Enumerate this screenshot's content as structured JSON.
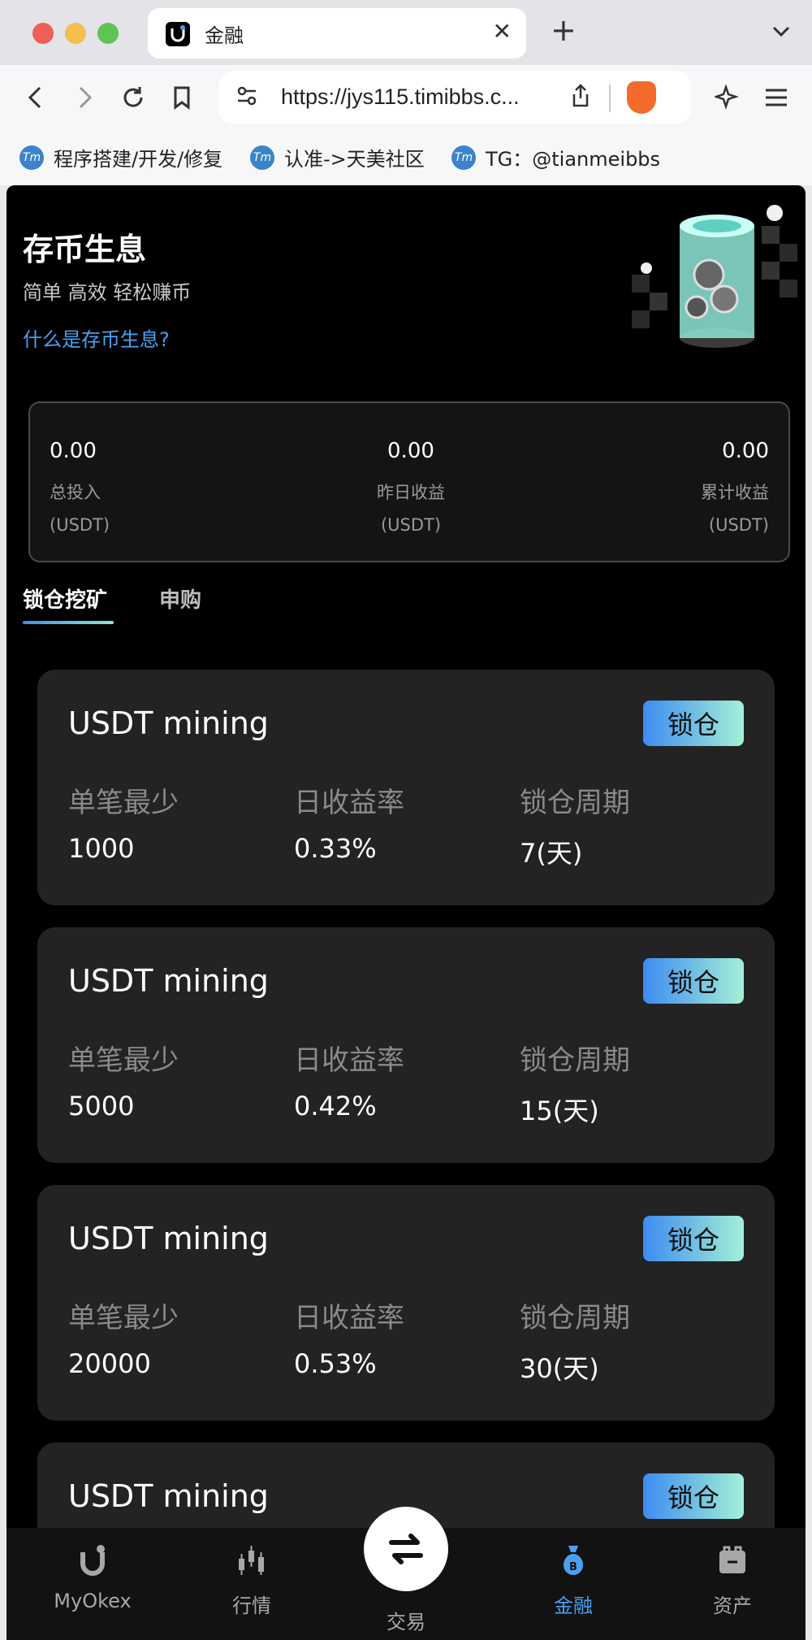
{
  "browser": {
    "tab_title": "金融",
    "tab_close": "✕",
    "new_tab": "+",
    "url": "https://jys115.timibbs.c...",
    "bookmarks": [
      {
        "label": "程序搭建/开发/修复"
      },
      {
        "label": "认准->天美社区"
      },
      {
        "label": "TG：@tianmeibbs"
      }
    ]
  },
  "hero": {
    "title": "存币生息",
    "subtitle": "简单 高效 轻松赚币",
    "link": "什么是存币生息?"
  },
  "summary": [
    {
      "value": "0.00",
      "label": "总投入",
      "unit": "(USDT)"
    },
    {
      "value": "0.00",
      "label": "昨日收益",
      "unit": "(USDT)"
    },
    {
      "value": "0.00",
      "label": "累计收益",
      "unit": "(USDT)"
    }
  ],
  "tabs": {
    "active": "锁仓挖矿",
    "inactive": "申购"
  },
  "cards": [
    {
      "title": "USDT mining",
      "button": "锁仓",
      "min_label": "单笔最少",
      "min": "1000",
      "rate_label": "日收益率",
      "rate": "0.33%",
      "period_label": "锁仓周期",
      "period": "7(天)"
    },
    {
      "title": "USDT mining",
      "button": "锁仓",
      "min_label": "单笔最少",
      "min": "5000",
      "rate_label": "日收益率",
      "rate": "0.42%",
      "period_label": "锁仓周期",
      "period": "15(天)"
    },
    {
      "title": "USDT mining",
      "button": "锁仓",
      "min_label": "单笔最少",
      "min": "20000",
      "rate_label": "日收益率",
      "rate": "0.53%",
      "period_label": "锁仓周期",
      "period": "30(天)"
    },
    {
      "title": "USDT mining",
      "button": "锁仓"
    }
  ],
  "nav": {
    "items": [
      {
        "label": "MyOkex",
        "icon": "okex-logo-icon"
      },
      {
        "label": "行情",
        "icon": "candlestick-icon"
      },
      {
        "label": "交易",
        "icon": "swap-arrows-icon"
      },
      {
        "label": "金融",
        "icon": "money-bag-icon"
      },
      {
        "label": "资产",
        "icon": "wallet-icon"
      }
    ],
    "active_index": 3,
    "accent_color": "#4aa0f0"
  }
}
